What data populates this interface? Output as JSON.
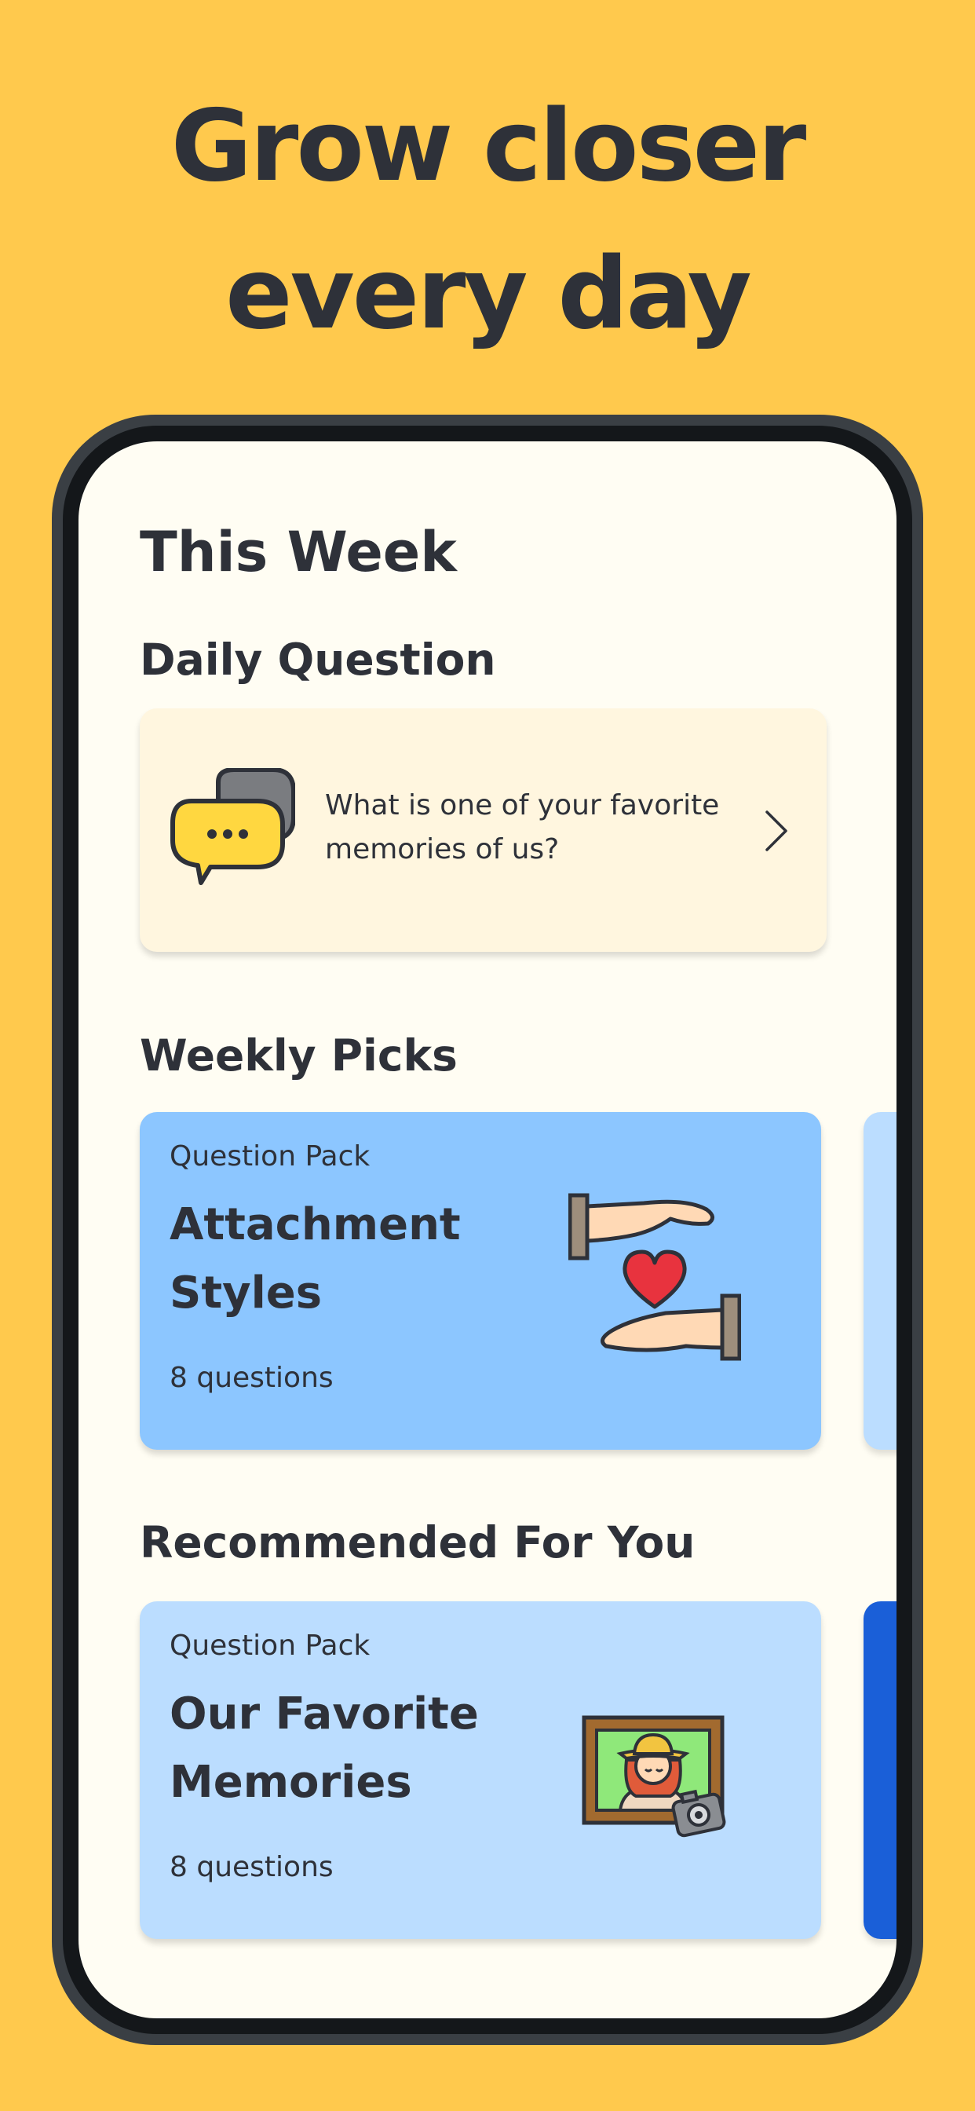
{
  "headline": {
    "line1": "Grow closer",
    "line2": "every day"
  },
  "screen": {
    "title": "This Week",
    "daily": {
      "heading": "Daily Question",
      "question": "What is one of your favorite memories of us?",
      "icon": "chat-bubbles-icon"
    },
    "weekly": {
      "heading": "Weekly Picks",
      "card": {
        "kicker": "Question Pack",
        "title": "Attachment Styles",
        "count": "8 questions",
        "icon": "hands-heart-icon",
        "color": "#8CC6FF"
      },
      "peek_color": "#BBDDFF"
    },
    "recommended": {
      "heading": "Recommended For You",
      "card": {
        "kicker": "Question Pack",
        "title": "Our Favorite Memories",
        "count": "8 questions",
        "icon": "framed-photo-camera-icon",
        "color": "#BBDDFF"
      },
      "peek_color": "#1A5FD8"
    }
  },
  "colors": {
    "background": "#FFC94D",
    "screen": "#FFFDF3",
    "text": "#2E3139"
  }
}
